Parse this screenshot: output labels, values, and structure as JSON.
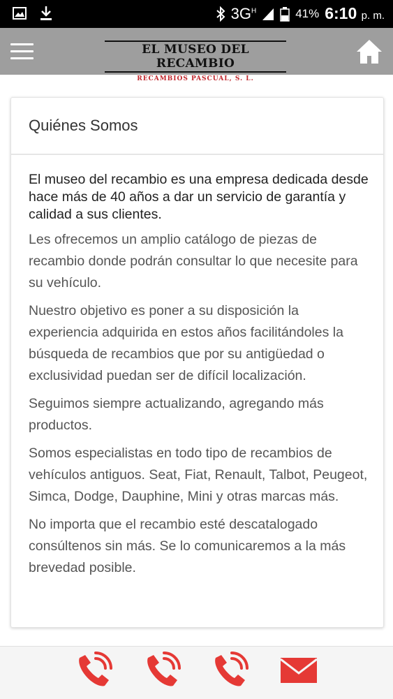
{
  "status_bar": {
    "network": "3G",
    "network_sup": "H",
    "battery": "41%",
    "time": "6:10",
    "time_suffix": "p. m."
  },
  "header": {
    "logo_title": "EL MUSEO DEL RECAMBIO",
    "logo_subtitle": "RECAMBIOS PASCUAL, S. L.",
    "icons": {
      "menu": "menu-icon",
      "home": "home-icon"
    }
  },
  "card": {
    "title": "Quiénes Somos",
    "paragraphs": [
      "El museo del recambio es una empresa dedicada desde hace más de 40 años a dar un servicio de garantía y calidad a sus clientes.",
      "Les ofrecemos un amplio catálogo de piezas de recambio donde podrán consultar lo que necesite para su vehículo.",
      "Nuestro objetivo es poner a su disposición la experiencia adquirida en estos años facilitándoles la búsqueda de recambios que por su antigüedad o exclusividad puedan ser de difícil localización.",
      "Seguimos siempre actualizando, agregando más productos.",
      "Somos especialistas en todo tipo de recambios de vehículos antiguos. Seat, Fiat, Renault, Talbot, Peugeot, Simca, Dodge, Dauphine, Mini y otras marcas más.",
      "No importa que el recambio esté descatalogado consúltenos sin más. Se lo comunicaremos a la más brevedad posible."
    ]
  },
  "bottom_bar": {
    "actions": [
      "phone-icon",
      "phone-icon",
      "phone-icon",
      "mail-icon"
    ],
    "accent": "#e53935"
  }
}
